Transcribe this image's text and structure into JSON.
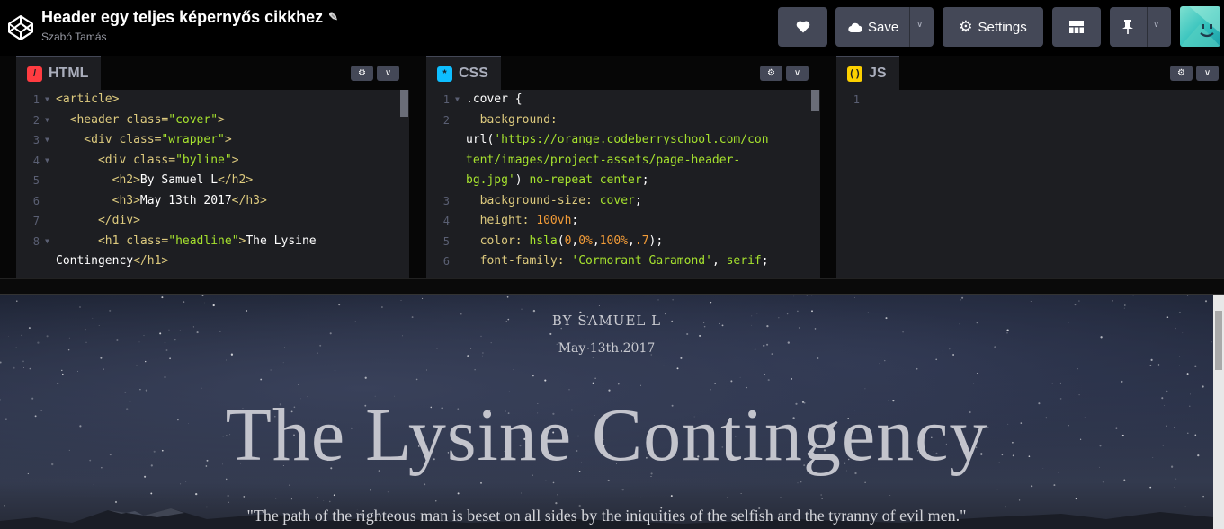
{
  "project": {
    "title": "Header egy teljes képernyős cikkhez",
    "author": "Szabó Tamás"
  },
  "toolbar": {
    "save_label": "Save",
    "settings_label": "Settings"
  },
  "editors": {
    "html": {
      "label": "HTML",
      "lines": [
        {
          "n": "1",
          "fold": true,
          "parts": [
            {
              "c": "t-tag",
              "t": "<article>"
            }
          ]
        },
        {
          "n": "2",
          "fold": true,
          "parts": [
            {
              "c": "t-tag",
              "t": "  <header "
            },
            {
              "c": "t-attr",
              "t": "class="
            },
            {
              "c": "t-str",
              "t": "\"cover\""
            },
            {
              "c": "t-tag",
              "t": ">"
            }
          ]
        },
        {
          "n": "3",
          "fold": true,
          "parts": [
            {
              "c": "t-tag",
              "t": "    <div "
            },
            {
              "c": "t-attr",
              "t": "class="
            },
            {
              "c": "t-str",
              "t": "\"wrapper\""
            },
            {
              "c": "t-tag",
              "t": ">"
            }
          ]
        },
        {
          "n": "4",
          "fold": true,
          "parts": [
            {
              "c": "t-tag",
              "t": "      <div "
            },
            {
              "c": "t-attr",
              "t": "class="
            },
            {
              "c": "t-str",
              "t": "\"byline\""
            },
            {
              "c": "t-tag",
              "t": ">"
            }
          ]
        },
        {
          "n": "5",
          "fold": false,
          "parts": [
            {
              "c": "t-tag",
              "t": "        <h2>"
            },
            {
              "c": "t-plain",
              "t": "By Samuel L"
            },
            {
              "c": "t-tag",
              "t": "</h2>"
            }
          ]
        },
        {
          "n": "6",
          "fold": false,
          "parts": [
            {
              "c": "t-tag",
              "t": "        <h3>"
            },
            {
              "c": "t-plain",
              "t": "May 13th 2017"
            },
            {
              "c": "t-tag",
              "t": "</h3>"
            }
          ]
        },
        {
          "n": "7",
          "fold": false,
          "parts": [
            {
              "c": "t-tag",
              "t": "      </div>"
            }
          ]
        },
        {
          "n": "8",
          "fold": true,
          "parts": [
            {
              "c": "t-tag",
              "t": "      <h1 "
            },
            {
              "c": "t-attr",
              "t": "class="
            },
            {
              "c": "t-str",
              "t": "\"headline\""
            },
            {
              "c": "t-tag",
              "t": ">"
            },
            {
              "c": "t-plain",
              "t": "The Lysine"
            }
          ]
        },
        {
          "n": "",
          "fold": false,
          "parts": [
            {
              "c": "t-plain",
              "t": "Contingency"
            },
            {
              "c": "t-tag",
              "t": "</h1>"
            }
          ]
        }
      ]
    },
    "css": {
      "label": "CSS",
      "lines": [
        {
          "n": "1",
          "fold": true,
          "parts": [
            {
              "c": "t-sel",
              "t": ".cover {"
            }
          ]
        },
        {
          "n": "2",
          "fold": false,
          "parts": [
            {
              "c": "t-prop",
              "t": "  background:"
            }
          ]
        },
        {
          "n": "",
          "fold": false,
          "parts": [
            {
              "c": "t-plain",
              "t": "url("
            },
            {
              "c": "t-url",
              "t": "'https://orange.codeberryschool.com/con"
            }
          ]
        },
        {
          "n": "",
          "fold": false,
          "parts": [
            {
              "c": "t-url",
              "t": "tent/images/project-assets/page-header-"
            }
          ]
        },
        {
          "n": "",
          "fold": false,
          "parts": [
            {
              "c": "t-url",
              "t": "bg.jpg'"
            },
            {
              "c": "t-plain",
              "t": ") "
            },
            {
              "c": "t-str",
              "t": "no-repeat center"
            },
            {
              "c": "t-plain",
              "t": ";"
            }
          ]
        },
        {
          "n": "3",
          "fold": false,
          "parts": [
            {
              "c": "t-prop",
              "t": "  background-size: "
            },
            {
              "c": "t-str",
              "t": "cover"
            },
            {
              "c": "t-plain",
              "t": ";"
            }
          ]
        },
        {
          "n": "4",
          "fold": false,
          "parts": [
            {
              "c": "t-prop",
              "t": "  height: "
            },
            {
              "c": "t-num",
              "t": "100vh"
            },
            {
              "c": "t-plain",
              "t": ";"
            }
          ]
        },
        {
          "n": "5",
          "fold": false,
          "parts": [
            {
              "c": "t-prop",
              "t": "  color: "
            },
            {
              "c": "t-str",
              "t": "hsla"
            },
            {
              "c": "t-plain",
              "t": "("
            },
            {
              "c": "t-num",
              "t": "0"
            },
            {
              "c": "t-plain",
              "t": ","
            },
            {
              "c": "t-num",
              "t": "0%"
            },
            {
              "c": "t-plain",
              "t": ","
            },
            {
              "c": "t-num",
              "t": "100%"
            },
            {
              "c": "t-plain",
              "t": ","
            },
            {
              "c": "t-num",
              "t": ".7"
            },
            {
              "c": "t-plain",
              "t": ");"
            }
          ]
        },
        {
          "n": "6",
          "fold": false,
          "parts": [
            {
              "c": "t-prop",
              "t": "  font-family: "
            },
            {
              "c": "t-str",
              "t": "'Cormorant Garamond'"
            },
            {
              "c": "t-plain",
              "t": ", "
            },
            {
              "c": "t-str",
              "t": "serif"
            },
            {
              "c": "t-plain",
              "t": ";"
            }
          ]
        }
      ]
    },
    "js": {
      "label": "JS",
      "lines": [
        {
          "n": "1",
          "fold": false,
          "parts": []
        }
      ]
    }
  },
  "preview": {
    "byline": "BY SAMUEL L",
    "date": "May 13th 2017",
    "headline": "The Lysine Contingency",
    "quote": "\"The path of the righteous man is beset on all sides by the iniquities of the selfish and the tyranny of evil men.\""
  },
  "colors": {
    "html_icon": "#ff3c41",
    "css_icon": "#0ebeff",
    "js_icon": "#fcd000",
    "button_bg": "#444857"
  },
  "icons": {
    "logo": "codepen-logo-icon",
    "heart": "heart-icon",
    "cloud": "cloud-icon",
    "gear": "gear-icon",
    "layout": "layout-grid-icon",
    "pin": "pin-icon",
    "chevron": "chevron-down-icon"
  }
}
